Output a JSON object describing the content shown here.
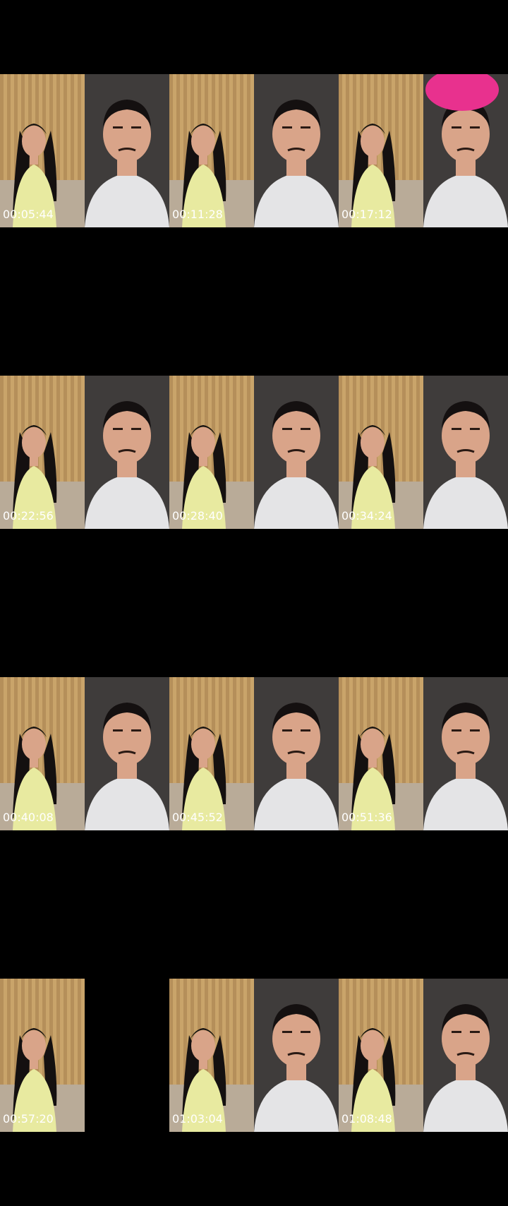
{
  "rows": [
    {
      "cells": [
        {
          "timestamp": "00:05:44",
          "left": "woman",
          "right": "man"
        },
        {
          "timestamp": "00:11:28",
          "left": "woman",
          "right": "man"
        },
        {
          "timestamp": "00:17:12",
          "left": "woman",
          "right": "man-bowl"
        }
      ]
    },
    {
      "cells": [
        {
          "timestamp": "00:22:56",
          "left": "woman",
          "right": "man"
        },
        {
          "timestamp": "00:28:40",
          "left": "woman",
          "right": "man"
        },
        {
          "timestamp": "00:34:24",
          "left": "woman",
          "right": "man"
        }
      ]
    },
    {
      "cells": [
        {
          "timestamp": "00:40:08",
          "left": "woman",
          "right": "man"
        },
        {
          "timestamp": "00:45:52",
          "left": "woman",
          "right": "man"
        },
        {
          "timestamp": "00:51:36",
          "left": "woman",
          "right": "man"
        }
      ]
    },
    {
      "cells": [
        {
          "timestamp": "00:57:20",
          "left": "woman",
          "right": "empty"
        },
        {
          "timestamp": "01:03:04",
          "left": "woman",
          "right": "man"
        },
        {
          "timestamp": "01:08:48",
          "left": "woman",
          "right": "man"
        }
      ]
    }
  ],
  "colors": {
    "curtain": "#c9a46a",
    "curtain_dark": "#8e6a3c",
    "wall": "#3f3c3b",
    "woman_top": "#e8eaa0",
    "man_shirt": "#e4e4e6",
    "skin": "#d9a489",
    "hair": "#141010",
    "bowl": "#e8318e"
  }
}
